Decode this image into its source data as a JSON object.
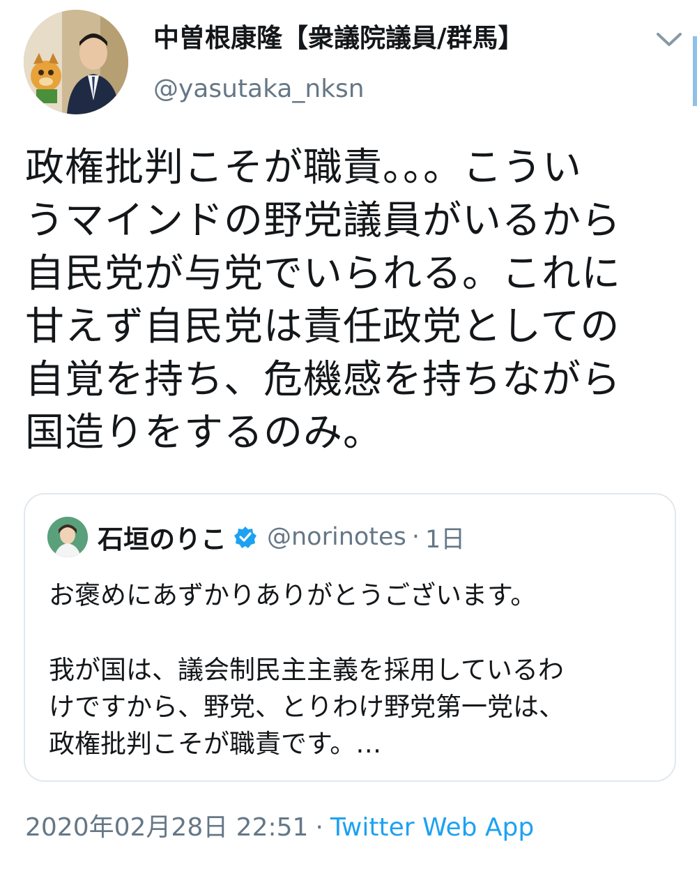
{
  "tweet": {
    "display_name": "中曽根康隆【衆議院議員/群馬】",
    "handle": "@yasutaka_nksn",
    "body_lines": [
      "政権批判こそが職責。。。こうい",
      "うマインドの野党議員がいるから",
      "自民党が与党でいられる。これに",
      "甘えず自民党は責任政党としての",
      "自覚を持ち、危機感を持ちながら",
      "国造りをするのみ。"
    ],
    "timestamp": "2020年02月28日 22:51",
    "separator": "·",
    "source": "Twitter Web App"
  },
  "quoted": {
    "display_name": "石垣のりこ",
    "handle": "@norinotes",
    "separator": "·",
    "time": "1日",
    "text_lines": [
      "お褒めにあずかりありがとうございます。",
      "",
      "我が国は、議会制民主主義を採用しているわ",
      "けですから、野党、とりわけ野党第一党は、",
      "政権批判こそが職責です。…"
    ]
  },
  "colors": {
    "text": "#14171a",
    "secondary": "#657786",
    "link": "#1da1f2",
    "border": "#e1e8ed",
    "verified": "#1da1f2"
  },
  "icons": {
    "author_avatar": "avatar-photo",
    "menu": "chevron-down-icon",
    "verified": "verified-badge-icon",
    "quoted_avatar": "avatar-photo"
  }
}
